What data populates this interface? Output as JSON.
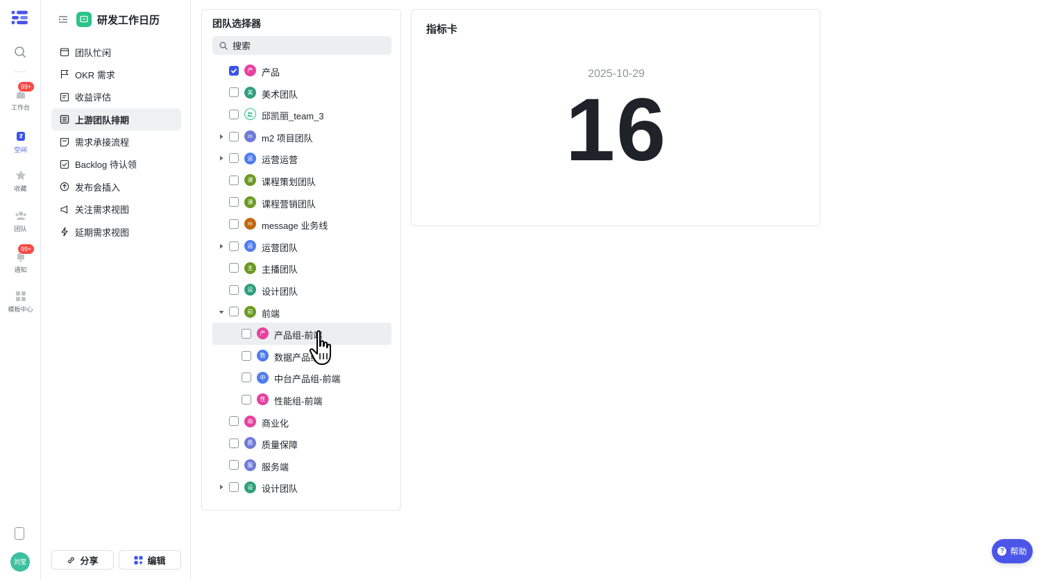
{
  "rail": {
    "items": [
      {
        "label": "工作台",
        "badge": "99+"
      },
      {
        "label": "空间"
      },
      {
        "label": "收藏"
      },
      {
        "label": "团队"
      },
      {
        "label": "通知",
        "badge": "99+"
      },
      {
        "label": "模板中心"
      }
    ],
    "user_avatar": "刘莹"
  },
  "nav": {
    "title": "研发工作日历",
    "items": [
      {
        "label": "团队忙闲"
      },
      {
        "label": "OKR 需求"
      },
      {
        "label": "收益评估"
      },
      {
        "label": "上游团队排期"
      },
      {
        "label": "需求承接流程"
      },
      {
        "label": "Backlog 待认领"
      },
      {
        "label": "发布会插入"
      },
      {
        "label": "关注需求视图"
      },
      {
        "label": "延期需求视图"
      }
    ],
    "share_label": "分享",
    "edit_label": "编辑"
  },
  "team_selector": {
    "title": "团队选择器",
    "search_placeholder": "搜索",
    "rows": [
      {
        "label": "产品",
        "avatar": "产",
        "color": "#e8409f",
        "checked": true,
        "level": 0,
        "caret": ""
      },
      {
        "label": "美术团队",
        "avatar": "美",
        "color": "#2ea07b",
        "checked": false,
        "level": 0,
        "caret": ""
      },
      {
        "label": "邱凯丽_team_3",
        "avatar": "",
        "color": "#ffffff",
        "checked": false,
        "level": 0,
        "caret": ""
      },
      {
        "label": "m2 项目团队",
        "avatar": "m",
        "color": "#6f7ad8",
        "checked": false,
        "level": 0,
        "caret": "right"
      },
      {
        "label": "运营运营",
        "avatar": "运",
        "color": "#4e7cf0",
        "checked": false,
        "level": 0,
        "caret": "right"
      },
      {
        "label": "课程策划团队",
        "avatar": "课",
        "color": "#6a9a1f",
        "checked": false,
        "level": 0,
        "caret": ""
      },
      {
        "label": "课程营销团队",
        "avatar": "课",
        "color": "#6a9a1f",
        "checked": false,
        "level": 0,
        "caret": ""
      },
      {
        "label": "message 业务线",
        "avatar": "m",
        "color": "#c2680e",
        "checked": false,
        "level": 0,
        "caret": ""
      },
      {
        "label": "运营团队",
        "avatar": "运",
        "color": "#4e7cf0",
        "checked": false,
        "level": 0,
        "caret": "right"
      },
      {
        "label": "主播团队",
        "avatar": "主",
        "color": "#6a9a1f",
        "checked": false,
        "level": 0,
        "caret": ""
      },
      {
        "label": "设计团队",
        "avatar": "设",
        "color": "#2ea07b",
        "checked": false,
        "level": 0,
        "caret": ""
      },
      {
        "label": "前端",
        "avatar": "前",
        "color": "#6a9a1f",
        "checked": false,
        "level": 0,
        "caret": "down"
      },
      {
        "label": "产品组-前端",
        "avatar": "产",
        "color": "#e8409f",
        "checked": false,
        "level": 1,
        "caret": "",
        "hover": true
      },
      {
        "label": "数据产品组",
        "avatar": "数",
        "color": "#4e7cf0",
        "checked": false,
        "level": 1,
        "caret": ""
      },
      {
        "label": "中台产品组-前端",
        "avatar": "中",
        "color": "#4e7cf0",
        "checked": false,
        "level": 1,
        "caret": ""
      },
      {
        "label": "性能组-前端",
        "avatar": "性",
        "color": "#e8409f",
        "checked": false,
        "level": 1,
        "caret": ""
      },
      {
        "label": "商业化",
        "avatar": "商",
        "color": "#e8409f",
        "checked": false,
        "level": 0,
        "caret": ""
      },
      {
        "label": "质量保障",
        "avatar": "质",
        "color": "#6f7ad8",
        "checked": false,
        "level": 0,
        "caret": ""
      },
      {
        "label": "服务端",
        "avatar": "服",
        "color": "#6f7ad8",
        "checked": false,
        "level": 0,
        "caret": ""
      },
      {
        "label": "设计团队",
        "avatar": "设",
        "color": "#2ea07b",
        "checked": false,
        "level": 0,
        "caret": "right"
      }
    ]
  },
  "metric_card": {
    "title": "指标卡",
    "date": "2025-10-29",
    "value": "16"
  },
  "help_label": "帮助",
  "colors": {
    "accent": "#3a54e8",
    "help": "#4b55e8",
    "badge": "#f54a45",
    "space_icon": "#2bc38a"
  }
}
